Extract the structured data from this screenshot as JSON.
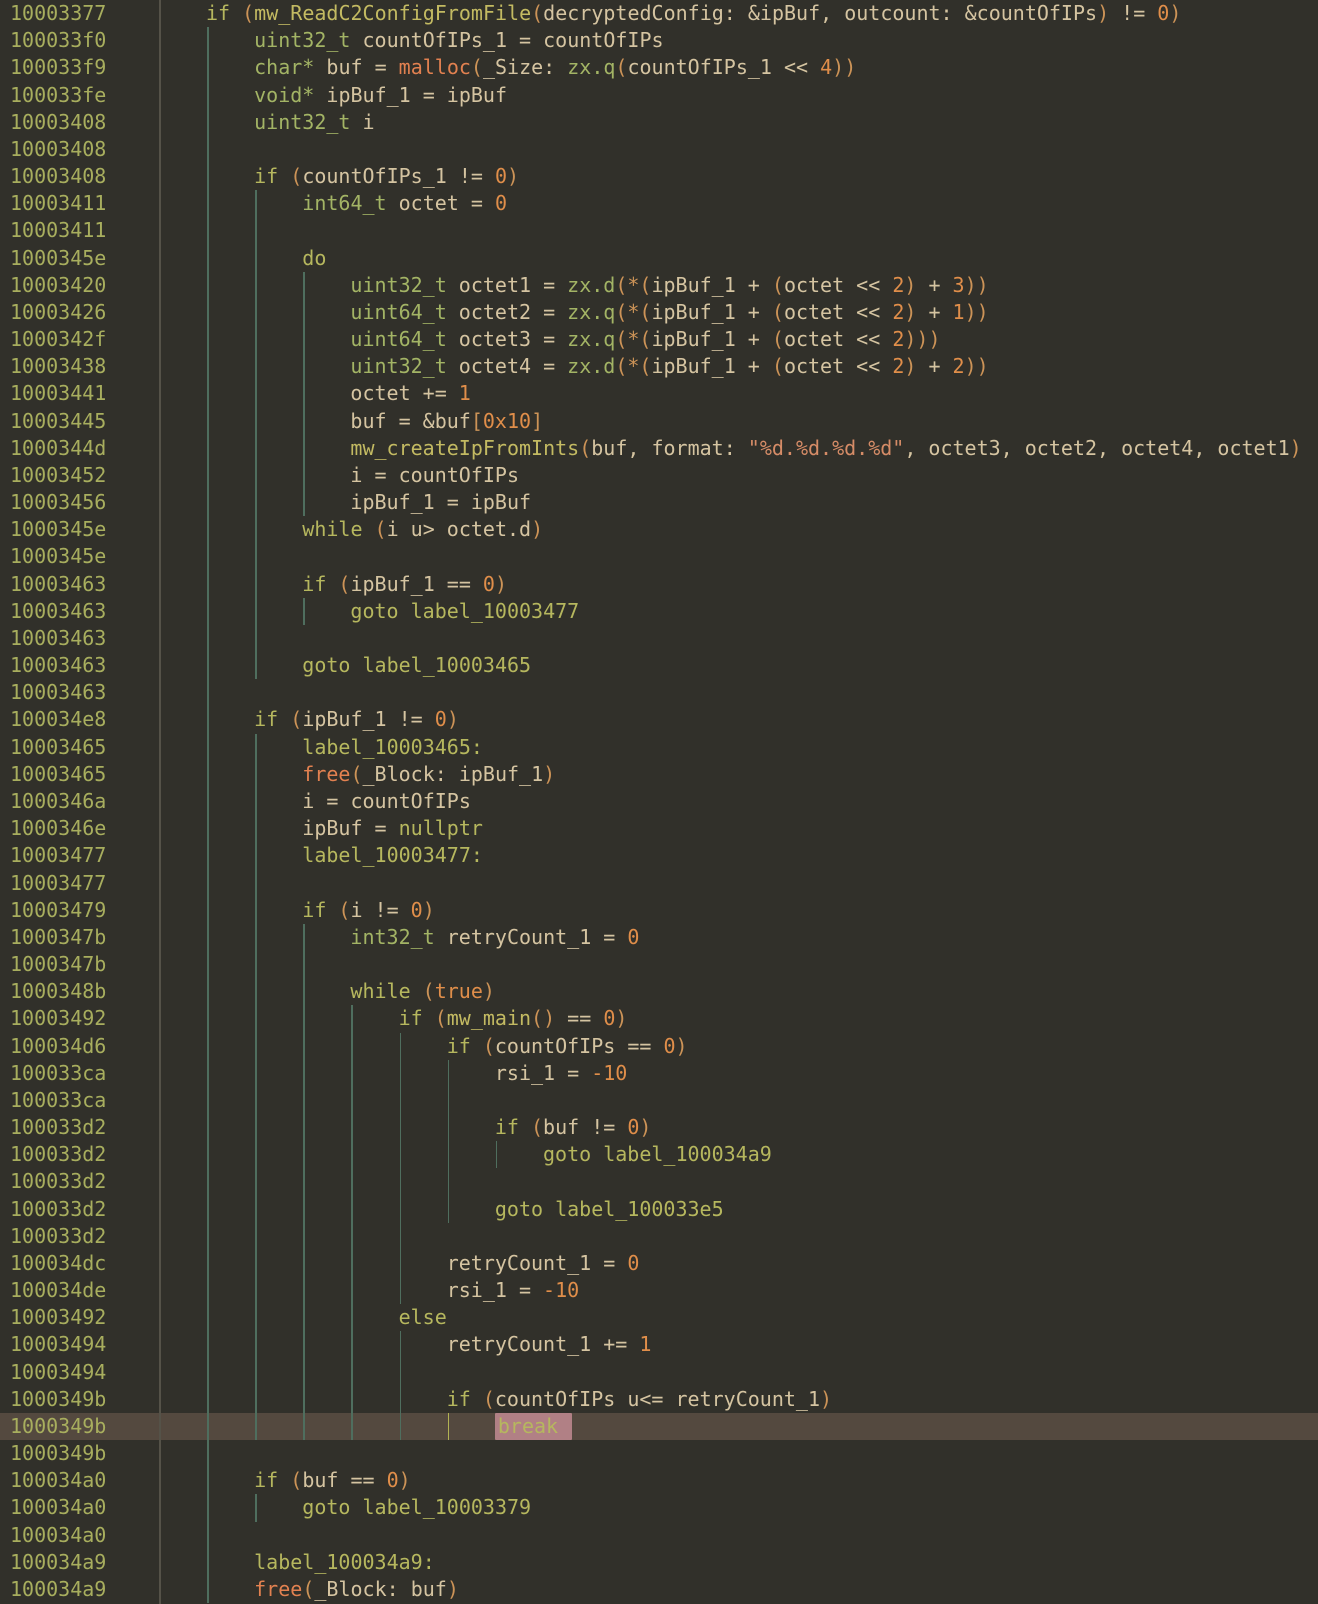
{
  "view": "decompiler-pseudocode",
  "palette": {
    "bg": "#31302a",
    "addr": "#a8ae5e",
    "sep": "#555248",
    "guide": "#4f6e5e",
    "guidehl": "#b2b354",
    "kw": "#b6b75e",
    "ty": "#a3b465",
    "fn": "#c3ba62",
    "im": "#e28150",
    "v": "#d5c4a1",
    "n": "#e08e4a",
    "s": "#d68c67",
    "p": "#cc9357",
    "hlrow": "#54493f",
    "tokhl": "#b18085"
  },
  "lines": [
    {
      "addr": "10003377",
      "indent": 0,
      "guides": [],
      "tokens": [
        [
          "kw",
          "if "
        ],
        [
          "p",
          "("
        ],
        [
          "fn",
          "mw_ReadC2ConfigFromFile"
        ],
        [
          "p",
          "("
        ],
        [
          "v",
          "decryptedConfig: &ipBuf, outcount: &countOfIPs"
        ],
        [
          "p",
          ")"
        ],
        [
          "v",
          " != "
        ],
        [
          "n",
          "0"
        ],
        [
          "p",
          ")"
        ]
      ]
    },
    {
      "addr": "100033f0",
      "indent": 1,
      "guides": [
        0
      ],
      "tokens": [
        [
          "ty",
          "uint32_t"
        ],
        [
          "v",
          " countOfIPs_1 = countOfIPs"
        ]
      ]
    },
    {
      "addr": "100033f9",
      "indent": 1,
      "guides": [
        0
      ],
      "tokens": [
        [
          "ty",
          "char*"
        ],
        [
          "v",
          " buf = "
        ],
        [
          "im",
          "malloc"
        ],
        [
          "p",
          "("
        ],
        [
          "v",
          "_Size: "
        ],
        [
          "ty",
          "zx.q"
        ],
        [
          "p",
          "("
        ],
        [
          "v",
          "countOfIPs_1 << "
        ],
        [
          "n",
          "4"
        ],
        [
          "p",
          "))"
        ]
      ]
    },
    {
      "addr": "100033fe",
      "indent": 1,
      "guides": [
        0
      ],
      "tokens": [
        [
          "ty",
          "void*"
        ],
        [
          "v",
          " ipBuf_1 = ipBuf"
        ]
      ]
    },
    {
      "addr": "10003408",
      "indent": 1,
      "guides": [
        0
      ],
      "tokens": [
        [
          "ty",
          "uint32_t"
        ],
        [
          "v",
          " i"
        ]
      ]
    },
    {
      "addr": "10003408",
      "indent": 1,
      "guides": [
        0
      ],
      "tokens": []
    },
    {
      "addr": "10003408",
      "indent": 1,
      "guides": [
        0
      ],
      "tokens": [
        [
          "kw",
          "if "
        ],
        [
          "p",
          "("
        ],
        [
          "v",
          "countOfIPs_1 != "
        ],
        [
          "n",
          "0"
        ],
        [
          "p",
          ")"
        ]
      ]
    },
    {
      "addr": "10003411",
      "indent": 2,
      "guides": [
        0,
        1
      ],
      "tokens": [
        [
          "ty",
          "int64_t"
        ],
        [
          "v",
          " octet = "
        ],
        [
          "n",
          "0"
        ]
      ]
    },
    {
      "addr": "10003411",
      "indent": 2,
      "guides": [
        0,
        1
      ],
      "tokens": []
    },
    {
      "addr": "1000345e",
      "indent": 2,
      "guides": [
        0,
        1
      ],
      "tokens": [
        [
          "kw",
          "do"
        ]
      ]
    },
    {
      "addr": "10003420",
      "indent": 3,
      "guides": [
        0,
        1,
        2
      ],
      "tokens": [
        [
          "ty",
          "uint32_t"
        ],
        [
          "v",
          " octet1 = "
        ],
        [
          "ty",
          "zx.d"
        ],
        [
          "p",
          "(*("
        ],
        [
          "v",
          "ipBuf_1 + "
        ],
        [
          "p",
          "("
        ],
        [
          "v",
          "octet << "
        ],
        [
          "n",
          "2"
        ],
        [
          "p",
          ")"
        ],
        [
          "v",
          " + "
        ],
        [
          "n",
          "3"
        ],
        [
          "p",
          "))"
        ]
      ]
    },
    {
      "addr": "10003426",
      "indent": 3,
      "guides": [
        0,
        1,
        2
      ],
      "tokens": [
        [
          "ty",
          "uint64_t"
        ],
        [
          "v",
          " octet2 = "
        ],
        [
          "ty",
          "zx.q"
        ],
        [
          "p",
          "(*("
        ],
        [
          "v",
          "ipBuf_1 + "
        ],
        [
          "p",
          "("
        ],
        [
          "v",
          "octet << "
        ],
        [
          "n",
          "2"
        ],
        [
          "p",
          ")"
        ],
        [
          "v",
          " + "
        ],
        [
          "n",
          "1"
        ],
        [
          "p",
          "))"
        ]
      ]
    },
    {
      "addr": "1000342f",
      "indent": 3,
      "guides": [
        0,
        1,
        2
      ],
      "tokens": [
        [
          "ty",
          "uint64_t"
        ],
        [
          "v",
          " octet3 = "
        ],
        [
          "ty",
          "zx.q"
        ],
        [
          "p",
          "(*("
        ],
        [
          "v",
          "ipBuf_1 + "
        ],
        [
          "p",
          "("
        ],
        [
          "v",
          "octet << "
        ],
        [
          "n",
          "2"
        ],
        [
          "p",
          ")))"
        ]
      ]
    },
    {
      "addr": "10003438",
      "indent": 3,
      "guides": [
        0,
        1,
        2
      ],
      "tokens": [
        [
          "ty",
          "uint32_t"
        ],
        [
          "v",
          " octet4 = "
        ],
        [
          "ty",
          "zx.d"
        ],
        [
          "p",
          "(*("
        ],
        [
          "v",
          "ipBuf_1 + "
        ],
        [
          "p",
          "("
        ],
        [
          "v",
          "octet << "
        ],
        [
          "n",
          "2"
        ],
        [
          "p",
          ")"
        ],
        [
          "v",
          " + "
        ],
        [
          "n",
          "2"
        ],
        [
          "p",
          "))"
        ]
      ]
    },
    {
      "addr": "10003441",
      "indent": 3,
      "guides": [
        0,
        1,
        2
      ],
      "tokens": [
        [
          "v",
          "octet += "
        ],
        [
          "n",
          "1"
        ]
      ]
    },
    {
      "addr": "10003445",
      "indent": 3,
      "guides": [
        0,
        1,
        2
      ],
      "tokens": [
        [
          "v",
          "buf = &buf"
        ],
        [
          "p",
          "["
        ],
        [
          "n",
          "0x10"
        ],
        [
          "p",
          "]"
        ]
      ]
    },
    {
      "addr": "1000344d",
      "indent": 3,
      "guides": [
        0,
        1,
        2
      ],
      "tokens": [
        [
          "fn",
          "mw_createIpFromInts"
        ],
        [
          "p",
          "("
        ],
        [
          "v",
          "buf, format: "
        ],
        [
          "s",
          "\"%d.%d.%d.%d\""
        ],
        [
          "v",
          ", octet3, octet2, octet4, octet1"
        ],
        [
          "p",
          ")"
        ]
      ]
    },
    {
      "addr": "10003452",
      "indent": 3,
      "guides": [
        0,
        1,
        2
      ],
      "tokens": [
        [
          "v",
          "i = countOfIPs"
        ]
      ]
    },
    {
      "addr": "10003456",
      "indent": 3,
      "guides": [
        0,
        1,
        2
      ],
      "tokens": [
        [
          "v",
          "ipBuf_1 = ipBuf"
        ]
      ]
    },
    {
      "addr": "1000345e",
      "indent": 2,
      "guides": [
        0,
        1
      ],
      "tokens": [
        [
          "kw",
          "while "
        ],
        [
          "p",
          "("
        ],
        [
          "v",
          "i u> octet.d"
        ],
        [
          "p",
          ")"
        ]
      ]
    },
    {
      "addr": "1000345e",
      "indent": 2,
      "guides": [
        0,
        1
      ],
      "tokens": []
    },
    {
      "addr": "10003463",
      "indent": 2,
      "guides": [
        0,
        1
      ],
      "tokens": [
        [
          "kw",
          "if "
        ],
        [
          "p",
          "("
        ],
        [
          "v",
          "ipBuf_1 == "
        ],
        [
          "n",
          "0"
        ],
        [
          "p",
          ")"
        ]
      ]
    },
    {
      "addr": "10003463",
      "indent": 3,
      "guides": [
        0,
        1,
        2
      ],
      "tokens": [
        [
          "kw",
          "goto label_10003477"
        ]
      ]
    },
    {
      "addr": "10003463",
      "indent": 2,
      "guides": [
        0,
        1
      ],
      "tokens": []
    },
    {
      "addr": "10003463",
      "indent": 2,
      "guides": [
        0,
        1
      ],
      "tokens": [
        [
          "kw",
          "goto label_10003465"
        ]
      ]
    },
    {
      "addr": "10003463",
      "indent": 1,
      "guides": [
        0
      ],
      "tokens": []
    },
    {
      "addr": "100034e8",
      "indent": 1,
      "guides": [
        0
      ],
      "tokens": [
        [
          "kw",
          "if "
        ],
        [
          "p",
          "("
        ],
        [
          "v",
          "ipBuf_1 != "
        ],
        [
          "n",
          "0"
        ],
        [
          "p",
          ")"
        ]
      ]
    },
    {
      "addr": "10003465",
      "indent": 2,
      "guides": [
        0,
        1
      ],
      "tokens": [
        [
          "kw",
          "label_10003465:"
        ]
      ]
    },
    {
      "addr": "10003465",
      "indent": 2,
      "guides": [
        0,
        1
      ],
      "tokens": [
        [
          "im",
          "free"
        ],
        [
          "p",
          "("
        ],
        [
          "v",
          "_Block: ipBuf_1"
        ],
        [
          "p",
          ")"
        ]
      ]
    },
    {
      "addr": "1000346a",
      "indent": 2,
      "guides": [
        0,
        1
      ],
      "tokens": [
        [
          "v",
          "i = countOfIPs"
        ]
      ]
    },
    {
      "addr": "1000346e",
      "indent": 2,
      "guides": [
        0,
        1
      ],
      "tokens": [
        [
          "v",
          "ipBuf = "
        ],
        [
          "kw",
          "nullptr"
        ]
      ]
    },
    {
      "addr": "10003477",
      "indent": 2,
      "guides": [
        0,
        1
      ],
      "tokens": [
        [
          "kw",
          "label_10003477:"
        ]
      ]
    },
    {
      "addr": "10003477",
      "indent": 2,
      "guides": [
        0,
        1
      ],
      "tokens": []
    },
    {
      "addr": "10003479",
      "indent": 2,
      "guides": [
        0,
        1
      ],
      "tokens": [
        [
          "kw",
          "if "
        ],
        [
          "p",
          "("
        ],
        [
          "v",
          "i != "
        ],
        [
          "n",
          "0"
        ],
        [
          "p",
          ")"
        ]
      ]
    },
    {
      "addr": "1000347b",
      "indent": 3,
      "guides": [
        0,
        1,
        2
      ],
      "tokens": [
        [
          "ty",
          "int32_t"
        ],
        [
          "v",
          " retryCount_1 = "
        ],
        [
          "n",
          "0"
        ]
      ]
    },
    {
      "addr": "1000347b",
      "indent": 3,
      "guides": [
        0,
        1,
        2
      ],
      "tokens": []
    },
    {
      "addr": "1000348b",
      "indent": 3,
      "guides": [
        0,
        1,
        2
      ],
      "tokens": [
        [
          "kw",
          "while "
        ],
        [
          "p",
          "("
        ],
        [
          "n",
          "true"
        ],
        [
          "p",
          ")"
        ]
      ]
    },
    {
      "addr": "10003492",
      "indent": 4,
      "guides": [
        0,
        1,
        2,
        3
      ],
      "tokens": [
        [
          "kw",
          "if "
        ],
        [
          "p",
          "("
        ],
        [
          "fn",
          "mw_main"
        ],
        [
          "p",
          "()"
        ],
        [
          "v",
          " == "
        ],
        [
          "n",
          "0"
        ],
        [
          "p",
          ")"
        ]
      ]
    },
    {
      "addr": "100034d6",
      "indent": 5,
      "guides": [
        0,
        1,
        2,
        3,
        4
      ],
      "tokens": [
        [
          "kw",
          "if "
        ],
        [
          "p",
          "("
        ],
        [
          "v",
          "countOfIPs == "
        ],
        [
          "n",
          "0"
        ],
        [
          "p",
          ")"
        ]
      ]
    },
    {
      "addr": "100033ca",
      "indent": 6,
      "guides": [
        0,
        1,
        2,
        3,
        4,
        5
      ],
      "tokens": [
        [
          "v",
          "rsi_1 = "
        ],
        [
          "n",
          "-10"
        ]
      ]
    },
    {
      "addr": "100033ca",
      "indent": 6,
      "guides": [
        0,
        1,
        2,
        3,
        4,
        5
      ],
      "tokens": []
    },
    {
      "addr": "100033d2",
      "indent": 6,
      "guides": [
        0,
        1,
        2,
        3,
        4,
        5
      ],
      "tokens": [
        [
          "kw",
          "if "
        ],
        [
          "p",
          "("
        ],
        [
          "v",
          "buf != "
        ],
        [
          "n",
          "0"
        ],
        [
          "p",
          ")"
        ]
      ]
    },
    {
      "addr": "100033d2",
      "indent": 7,
      "guides": [
        0,
        1,
        2,
        3,
        4,
        5,
        6
      ],
      "tokens": [
        [
          "kw",
          "goto label_100034a9"
        ]
      ]
    },
    {
      "addr": "100033d2",
      "indent": 6,
      "guides": [
        0,
        1,
        2,
        3,
        4,
        5
      ],
      "tokens": []
    },
    {
      "addr": "100033d2",
      "indent": 6,
      "guides": [
        0,
        1,
        2,
        3,
        4,
        5
      ],
      "tokens": [
        [
          "kw",
          "goto label_100033e5"
        ]
      ]
    },
    {
      "addr": "100033d2",
      "indent": 5,
      "guides": [
        0,
        1,
        2,
        3,
        4
      ],
      "tokens": []
    },
    {
      "addr": "100034dc",
      "indent": 5,
      "guides": [
        0,
        1,
        2,
        3,
        4
      ],
      "tokens": [
        [
          "v",
          "retryCount_1 = "
        ],
        [
          "n",
          "0"
        ]
      ]
    },
    {
      "addr": "100034de",
      "indent": 5,
      "guides": [
        0,
        1,
        2,
        3,
        4
      ],
      "tokens": [
        [
          "v",
          "rsi_1 = "
        ],
        [
          "n",
          "-10"
        ]
      ]
    },
    {
      "addr": "10003492",
      "indent": 4,
      "guides": [
        0,
        1,
        2,
        3
      ],
      "tokens": [
        [
          "kw",
          "else"
        ]
      ]
    },
    {
      "addr": "10003494",
      "indent": 5,
      "guides": [
        0,
        1,
        2,
        3,
        4
      ],
      "tokens": [
        [
          "v",
          "retryCount_1 += "
        ],
        [
          "n",
          "1"
        ]
      ]
    },
    {
      "addr": "10003494",
      "indent": 5,
      "guides": [
        0,
        1,
        2,
        3,
        4
      ],
      "tokens": []
    },
    {
      "addr": "1000349b",
      "indent": 5,
      "guides": [
        0,
        1,
        2,
        3,
        4
      ],
      "tokens": [
        [
          "kw",
          "if "
        ],
        [
          "p",
          "("
        ],
        [
          "v",
          "countOfIPs u<= retryCount_1"
        ],
        [
          "p",
          ")"
        ]
      ]
    },
    {
      "addr": "1000349b",
      "indent": 6,
      "guides": [
        0,
        1,
        2,
        3,
        4
      ],
      "hlGuide": 5,
      "rowHighlight": true,
      "tokens": [
        [
          "kw",
          "break",
          "hl"
        ]
      ]
    },
    {
      "addr": "1000349b",
      "indent": 1,
      "guides": [
        0
      ],
      "tokens": []
    },
    {
      "addr": "100034a0",
      "indent": 1,
      "guides": [
        0
      ],
      "tokens": [
        [
          "kw",
          "if "
        ],
        [
          "p",
          "("
        ],
        [
          "v",
          "buf == "
        ],
        [
          "n",
          "0"
        ],
        [
          "p",
          ")"
        ]
      ]
    },
    {
      "addr": "100034a0",
      "indent": 2,
      "guides": [
        0,
        1
      ],
      "tokens": [
        [
          "kw",
          "goto label_10003379"
        ]
      ]
    },
    {
      "addr": "100034a0",
      "indent": 1,
      "guides": [
        0
      ],
      "tokens": []
    },
    {
      "addr": "100034a9",
      "indent": 1,
      "guides": [
        0
      ],
      "tokens": [
        [
          "kw",
          "label_100034a9:"
        ]
      ]
    },
    {
      "addr": "100034a9",
      "indent": 1,
      "guides": [
        0
      ],
      "tokens": [
        [
          "im",
          "free"
        ],
        [
          "p",
          "("
        ],
        [
          "v",
          "_Block: buf"
        ],
        [
          "p",
          ")"
        ]
      ]
    }
  ]
}
